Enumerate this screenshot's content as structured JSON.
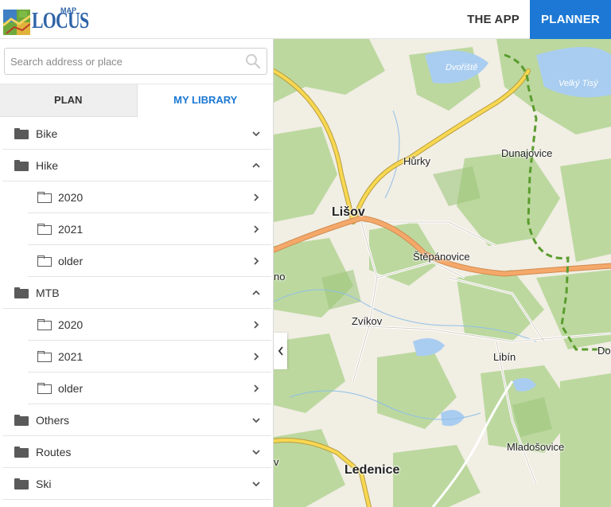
{
  "header": {
    "logo": {
      "word": "LOCUS",
      "map": "MAP"
    },
    "nav": [
      {
        "label": "THE APP",
        "active": false
      },
      {
        "label": "PLANNER",
        "active": true
      }
    ]
  },
  "sidebar": {
    "search": {
      "placeholder": "Search address or place",
      "value": ""
    },
    "tabs": [
      {
        "label": "PLAN",
        "active": false
      },
      {
        "label": "MY LIBRARY",
        "active": true
      }
    ],
    "folders": [
      {
        "label": "Bike",
        "expanded": false
      },
      {
        "label": "Hike",
        "expanded": true,
        "children": [
          {
            "label": "2020"
          },
          {
            "label": "2021"
          },
          {
            "label": "older"
          }
        ]
      },
      {
        "label": "MTB",
        "expanded": true,
        "children": [
          {
            "label": "2020"
          },
          {
            "label": "2021"
          },
          {
            "label": "older"
          }
        ]
      },
      {
        "label": "Others",
        "expanded": false
      },
      {
        "label": "Routes",
        "expanded": false
      },
      {
        "label": "Ski",
        "expanded": false
      }
    ]
  },
  "map": {
    "places": [
      {
        "name": "Dvořiště",
        "kind": "water"
      },
      {
        "name": "Velký Tisý",
        "kind": "water"
      },
      {
        "name": "Hůrky",
        "kind": "village"
      },
      {
        "name": "Dunajovice",
        "kind": "village"
      },
      {
        "name": "Lišov",
        "kind": "town"
      },
      {
        "name": "Štěpánovice",
        "kind": "village"
      },
      {
        "name": "no",
        "kind": "village"
      },
      {
        "name": "Zvíkov",
        "kind": "village"
      },
      {
        "name": "Libín",
        "kind": "village"
      },
      {
        "name": "Do",
        "kind": "village"
      },
      {
        "name": "Mladošovice",
        "kind": "village"
      },
      {
        "name": "Ledenice",
        "kind": "town"
      },
      {
        "name": "v",
        "kind": "village"
      }
    ]
  },
  "colors": {
    "accent": "#1c78d4",
    "forest": "#b8d79b",
    "water": "#a9cdf0",
    "main_road": "#f4a86a",
    "secondary_road": "#f8d851",
    "trail": "#5a9c2e"
  }
}
